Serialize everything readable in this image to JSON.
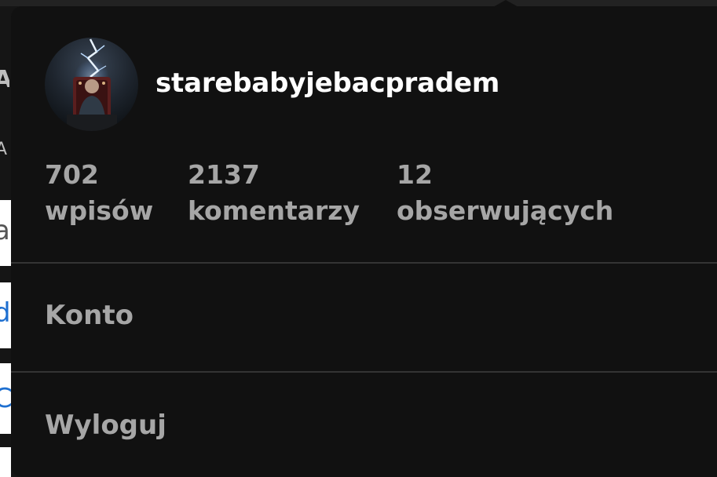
{
  "profile": {
    "username": "starebabyjebacpradem"
  },
  "stats": [
    {
      "value": "702",
      "label": "wpisów"
    },
    {
      "value": "2137",
      "label": "komentarzy"
    },
    {
      "value": "12",
      "label": "obserwujących"
    }
  ],
  "menu": {
    "account_label": "Konto",
    "logout_label": "Wyloguj"
  },
  "background": {
    "frag_a": "A",
    "frag_b": "A",
    "frag_c": "a",
    "frag_d": "d",
    "frag_e": "C"
  },
  "colors": {
    "panel_bg": "#111111",
    "username": "#ffffff",
    "muted_text": "#a6a6a6",
    "divider": "#343434",
    "link_blue": "#1e6fd0"
  },
  "icons": {
    "avatar": "avatar-image"
  }
}
